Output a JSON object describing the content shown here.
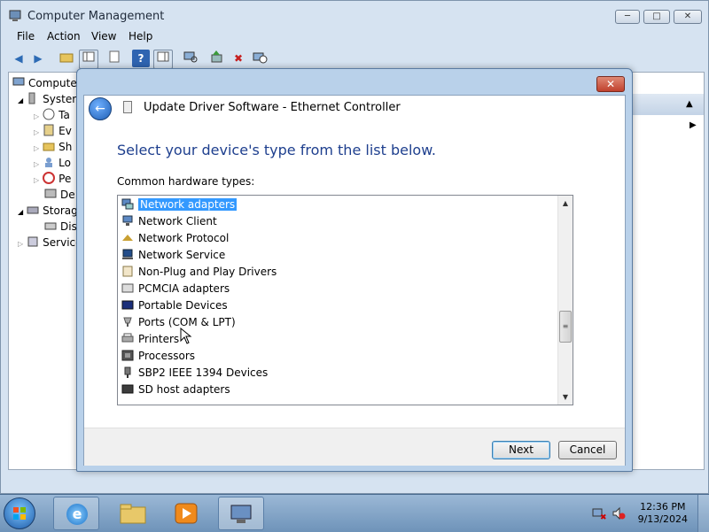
{
  "window": {
    "title": "Computer Management",
    "menus": [
      "File",
      "Action",
      "View",
      "Help"
    ],
    "tree": [
      {
        "label": "Computer",
        "indent": 0
      },
      {
        "label": "System",
        "indent": 1
      },
      {
        "label": "Ta",
        "indent": 2
      },
      {
        "label": "Ev",
        "indent": 2
      },
      {
        "label": "Sh",
        "indent": 2
      },
      {
        "label": "Lo",
        "indent": 2
      },
      {
        "label": "Pe",
        "indent": 2
      },
      {
        "label": "De",
        "indent": 2
      },
      {
        "label": "Storag",
        "indent": 1
      },
      {
        "label": "Dis",
        "indent": 2
      },
      {
        "label": "Service",
        "indent": 1
      }
    ]
  },
  "dialog": {
    "title": "Update Driver Software - Ethernet Controller",
    "instruction": "Select your device's type from the list below.",
    "list_label": "Common hardware types:",
    "items": [
      {
        "label": "Network adapters",
        "selected": true
      },
      {
        "label": "Network Client",
        "selected": false
      },
      {
        "label": "Network Protocol",
        "selected": false
      },
      {
        "label": "Network Service",
        "selected": false
      },
      {
        "label": "Non-Plug and Play Drivers",
        "selected": false
      },
      {
        "label": "PCMCIA adapters",
        "selected": false
      },
      {
        "label": "Portable Devices",
        "selected": false
      },
      {
        "label": "Ports (COM & LPT)",
        "selected": false
      },
      {
        "label": "Printers",
        "selected": false
      },
      {
        "label": "Processors",
        "selected": false
      },
      {
        "label": "SBP2 IEEE 1394 Devices",
        "selected": false
      },
      {
        "label": "SD host adapters",
        "selected": false
      }
    ],
    "next_label": "Next",
    "cancel_label": "Cancel"
  },
  "taskbar": {
    "time": "12:36 PM",
    "date": "9/13/2024"
  },
  "colors": {
    "selection": "#3399ff",
    "instruction_text": "#1e3f8e"
  }
}
